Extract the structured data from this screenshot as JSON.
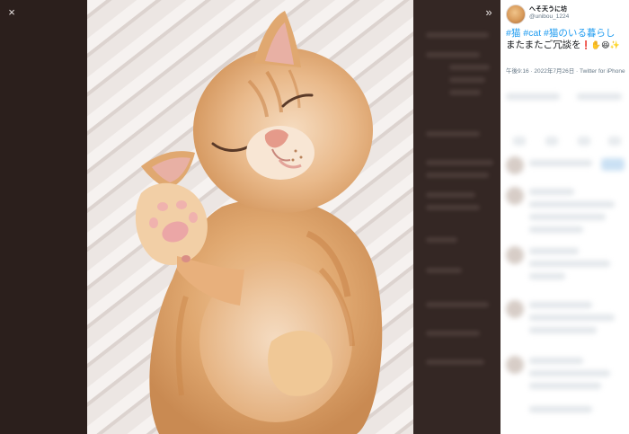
{
  "viewer": {
    "close_icon": "×",
    "collapse_icon": "»"
  },
  "tweet": {
    "author_name": "へそ天うに坊",
    "handle": "@unibou_1224",
    "hashtags": [
      "#猫",
      "#cat",
      "#猫のいる暮らし"
    ],
    "text": "またまたご冗談を",
    "emojis": "❗✋😆✨",
    "timestamp": "午後9:16 · 2022年7月26日 · Twitter for iPhone"
  },
  "colors": {
    "hashtag": "#1d9bf0",
    "backdrop": "#2b1f1c",
    "panel": "#ffffff"
  }
}
